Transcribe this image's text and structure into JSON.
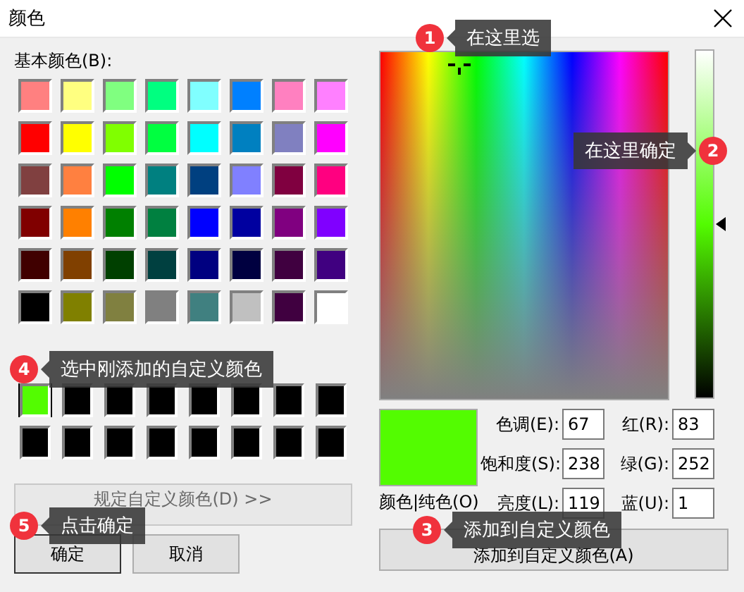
{
  "window": {
    "title": "颜色"
  },
  "basic_colors": {
    "label": "基本颜色(B):",
    "swatches": [
      {
        "color": "#ff8080"
      },
      {
        "color": "#ffff80"
      },
      {
        "color": "#80ff80"
      },
      {
        "color": "#00ff80"
      },
      {
        "color": "#80ffff"
      },
      {
        "color": "#0080ff"
      },
      {
        "color": "#ff80c0"
      },
      {
        "color": "#ff80ff"
      },
      {
        "color": "#ff0000"
      },
      {
        "color": "#ffff00"
      },
      {
        "color": "#80ff00"
      },
      {
        "color": "#00ff40"
      },
      {
        "color": "#00ffff"
      },
      {
        "color": "#0080c0"
      },
      {
        "color": "#8080c0"
      },
      {
        "color": "#ff00ff"
      },
      {
        "color": "#804040"
      },
      {
        "color": "#ff8040"
      },
      {
        "color": "#00ff00"
      },
      {
        "color": "#008080"
      },
      {
        "color": "#004080"
      },
      {
        "color": "#8080ff"
      },
      {
        "color": "#800040"
      },
      {
        "color": "#ff0080"
      },
      {
        "color": "#800000"
      },
      {
        "color": "#ff8000"
      },
      {
        "color": "#008000"
      },
      {
        "color": "#008040"
      },
      {
        "color": "#0000ff"
      },
      {
        "color": "#0000a0"
      },
      {
        "color": "#800080"
      },
      {
        "color": "#8000ff"
      },
      {
        "color": "#400000"
      },
      {
        "color": "#804000"
      },
      {
        "color": "#004000"
      },
      {
        "color": "#004040"
      },
      {
        "color": "#000080"
      },
      {
        "color": "#000040"
      },
      {
        "color": "#400040"
      },
      {
        "color": "#400080"
      },
      {
        "color": "#000000"
      },
      {
        "color": "#808000"
      },
      {
        "color": "#808040"
      },
      {
        "color": "#808080"
      },
      {
        "color": "#408080"
      },
      {
        "color": "#c0c0c0"
      },
      {
        "color": "#400040"
      },
      {
        "color": "#ffffff"
      }
    ]
  },
  "custom_colors": {
    "swatches": [
      {
        "color": "#53fc01",
        "selected": true
      },
      {
        "color": "#000000",
        "selected": false
      },
      {
        "color": "#000000",
        "selected": false
      },
      {
        "color": "#000000",
        "selected": false
      },
      {
        "color": "#000000",
        "selected": false
      },
      {
        "color": "#000000",
        "selected": false
      },
      {
        "color": "#000000",
        "selected": false
      },
      {
        "color": "#000000",
        "selected": false
      },
      {
        "color": "#000000",
        "selected": false
      },
      {
        "color": "#000000",
        "selected": false
      },
      {
        "color": "#000000",
        "selected": false
      },
      {
        "color": "#000000",
        "selected": false
      },
      {
        "color": "#000000",
        "selected": false
      },
      {
        "color": "#000000",
        "selected": false
      },
      {
        "color": "#000000",
        "selected": false
      },
      {
        "color": "#000000",
        "selected": false
      }
    ]
  },
  "define_button": {
    "label": "规定自定义颜色(D) >>",
    "disabled": true
  },
  "buttons": [
    {
      "label": "确定",
      "default": true
    },
    {
      "label": "取消",
      "default": false
    }
  ],
  "luminance": {
    "level": 0.5
  },
  "preview": {
    "color": "#53fc01",
    "label": "颜色|纯色(O)"
  },
  "fields": [
    {
      "label": "色调(E):",
      "value": "67"
    },
    {
      "label": "红(R):",
      "value": "83"
    },
    {
      "label": "饱和度(S):",
      "value": "238"
    },
    {
      "label": "绿(G):",
      "value": "252"
    },
    {
      "label": "亮度(L):",
      "value": "119"
    },
    {
      "label": "蓝(U):",
      "value": "1"
    }
  ],
  "add_button": {
    "label": "添加到自定义颜色(A)"
  },
  "callouts": [
    {
      "number": "1",
      "text": "在这里选"
    },
    {
      "number": "2",
      "text": "在这里确定"
    },
    {
      "number": "3",
      "text": "添加到自定义颜色"
    },
    {
      "number": "4",
      "text": "选中刚添加的自定义颜色"
    },
    {
      "number": "5",
      "text": "点击确定"
    }
  ]
}
